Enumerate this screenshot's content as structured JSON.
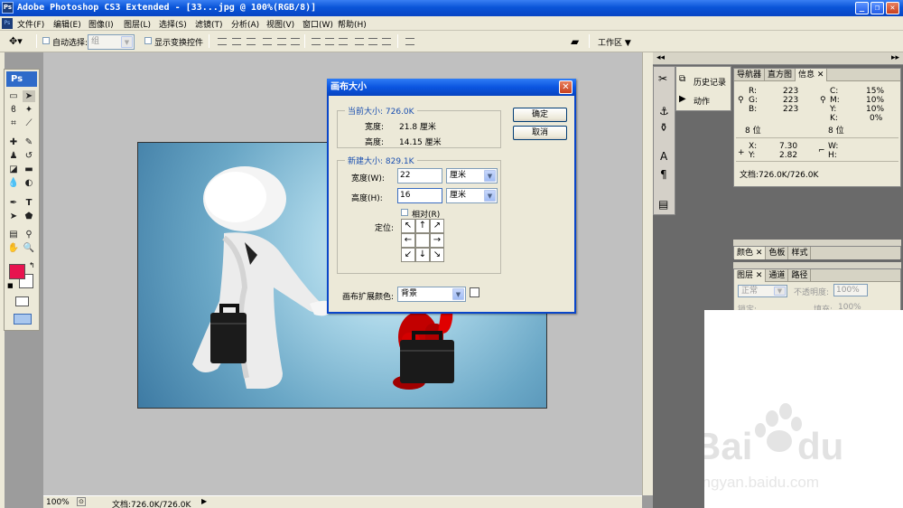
{
  "window": {
    "title": "Adobe Photoshop CS3 Extended - [33...jpg @ 100%(RGB/8)]",
    "app_icon": "Ps",
    "min": "_",
    "restore": "❐",
    "close": "✕"
  },
  "menus": [
    "文件(F)",
    "编辑(E)",
    "图像(I)",
    "图层(L)",
    "选择(S)",
    "滤镜(T)",
    "分析(A)",
    "视图(V)",
    "窗口(W)",
    "帮助(H)"
  ],
  "options": {
    "auto_select": "自动选择:",
    "auto_select_value": "组",
    "show_transform": "显示变换控件",
    "workspace": "工作区 ▼"
  },
  "toolbox": {
    "logo": "Ps",
    "foreground_color": "#e8134f",
    "background_color": "#ffffff"
  },
  "status": {
    "zoom": "100%",
    "doc": "文档:726.0K/726.0K"
  },
  "dialog": {
    "title": "画布大小",
    "close": "✕",
    "current_size_label": "当前大小: 726.0K",
    "width_label": "宽度:",
    "width_value": "21.8 厘米",
    "height_label": "高度:",
    "height_value": "14.15 厘米",
    "new_size_label": "新建大小: 829.1K",
    "new_width_label": "宽度(W):",
    "new_width_value": "22",
    "new_width_unit": "厘米",
    "new_height_label": "高度(H):",
    "new_height_value": "16",
    "new_height_unit": "厘米",
    "relative_label": "相对(R)",
    "anchor_label": "定位:",
    "anchor_arrows": [
      "↖",
      "↑",
      "↗",
      "←",
      "",
      "→",
      "↙",
      "↓",
      "↘"
    ],
    "ext_color_label": "画布扩展颜色:",
    "ext_color_value": "背景",
    "ok": "确定",
    "cancel": "取消"
  },
  "history_panel": {
    "history": "历史记录",
    "actions": "动作"
  },
  "info_panel": {
    "tabs": [
      "导航器",
      "直方图",
      "信息"
    ],
    "R": "223",
    "G": "223",
    "B": "223",
    "bits_left": "8 位",
    "C": "15%",
    "M": "10%",
    "Y": "10%",
    "K": "0%",
    "bits_right": "8 位",
    "X": "7.30",
    "Yc": "2.82",
    "W": "",
    "H": "",
    "doc": "文档:726.0K/726.0K",
    "labels": {
      "r": "R:",
      "g": "G:",
      "b": "B:",
      "c": "C:",
      "m": "M:",
      "y": "Y:",
      "k": "K:",
      "x": "X:",
      "yc": "Y:",
      "w": "W:",
      "h": "H:"
    }
  },
  "color_panel": {
    "tabs": [
      "颜色",
      "色板",
      "样式"
    ]
  },
  "layers_panel": {
    "tabs": [
      "图层",
      "通道",
      "路径"
    ],
    "mode": "正常",
    "opacity_label": "不透明度:",
    "opacity": "100%",
    "lock_label": "锁定:",
    "fill_label": "填充:",
    "fill": "100%"
  }
}
